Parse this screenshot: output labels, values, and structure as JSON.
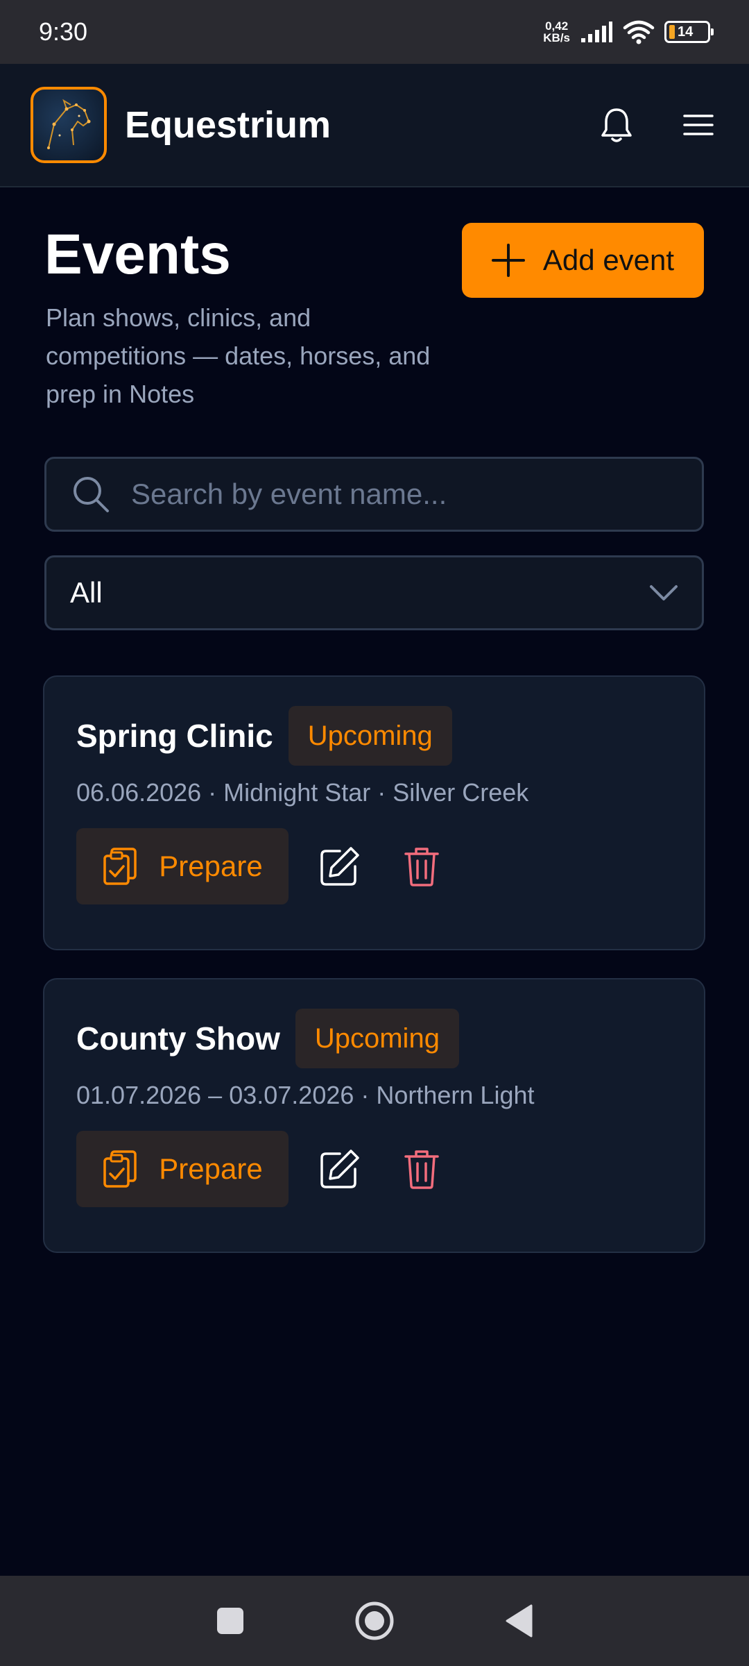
{
  "status_bar": {
    "time": "9:30",
    "net_speed_value": "0,42",
    "net_speed_unit": "KB/s",
    "battery_level": "14"
  },
  "header": {
    "app_name": "Equestrium",
    "icons": [
      "bell-icon",
      "menu-icon"
    ]
  },
  "page": {
    "title": "Events",
    "subtitle": "Plan shows, clinics, and competitions — dates, horses, and prep in Notes",
    "add_button_label": "Add event"
  },
  "search": {
    "placeholder": "Search by event name..."
  },
  "filter": {
    "selected": "All"
  },
  "events": [
    {
      "title": "Spring Clinic",
      "status": "Upcoming",
      "meta": "06.06.2026 · Midnight Star · Silver Creek",
      "prepare_label": "Prepare"
    },
    {
      "title": "County Show",
      "status": "Upcoming",
      "meta": "01.07.2026 – 03.07.2026 · Northern Light",
      "prepare_label": "Prepare"
    }
  ],
  "colors": {
    "accent": "#ff8a00",
    "background": "#030617",
    "card": "#111a2b",
    "danger": "#f26d7d",
    "muted_text": "#9aa6bd"
  }
}
